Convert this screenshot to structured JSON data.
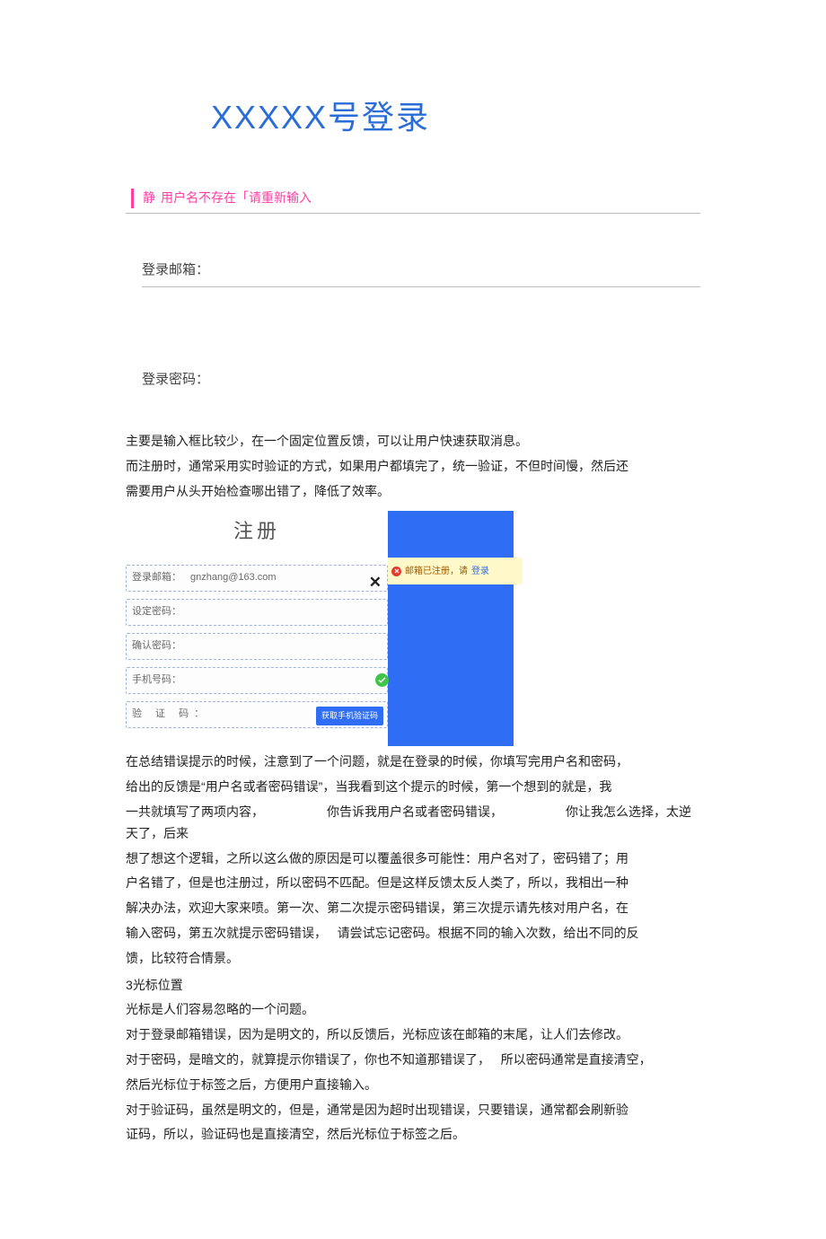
{
  "title": "XXXXX号登录",
  "error": {
    "jing": "静",
    "text": "用户名不存在「请重新输入"
  },
  "fields": {
    "email_label": "登录邮箱：",
    "password_label": "登录密码："
  },
  "para1": {
    "l1": "主要是输入框比较少，在一个固定位置反馈，可以让用户快速获取消息。",
    "l2": "而注册时，通常采用实时验证的方式，如果用户都填完了，统一验证，不但时间慢，然后还",
    "l3": "需要用户从头开始检查哪出错了，降低了效率。"
  },
  "embed": {
    "title": "注册",
    "email": {
      "label": "登录邮箱：",
      "value": "gnzhang@163.com"
    },
    "set_pwd_label": "设定密码：",
    "confirm_pwd_label": "确认密码：",
    "phone_label": "手机号码：",
    "verify_label": "验 证 码：",
    "get_code": "获取手机验证码",
    "warn_prefix": "邮箱已注册，请",
    "warn_login": "登录"
  },
  "para2": {
    "l1": "在总结错误提示的时候，注意到了一个问题，就是在登录的时候，你填写完用户名和密码，",
    "l2": "给出的反馈是“用户名或者密码错误”，当我看到这个提示的时候，第一个想到的就是，我",
    "l3a": "一共就填写了两项内容，",
    "l3b": "你告诉我用户名或者密码错误，",
    "l3c": "你让我怎么选择，太逆天了，后来",
    "l4": "想了想这个逻辑，之所以这么做的原因是可以覆盖很多可能性：用户名对了，密码错了；用",
    "l5": "户名错了，但是也注册过，所以密码不匹配。但是这样反馈太反人类了，所以，我相出一种",
    "l6": "解决办法，欢迎大家来喷。第一次、第二次提示密码错误，第三次提示请先核对用户名，在",
    "l7a": "输入密码，第五次就提示密码错误，",
    "l7b": "请尝试忘记密码。根据不同的输入次数，给出不同的反",
    "l8": "馈，比较符合情景。"
  },
  "section3": {
    "h": "3光标位置",
    "l1": "光标是人们容易忽略的一个问题。",
    "l2": "对于登录邮箱错误，因为是明文的，所以反馈后，光标应该在邮箱的末尾，让人们去修改。",
    "l3a": "对于密码，是暗文的，就算提示你错误了，你也不知道那错误了，",
    "l3b": "所以密码通常是直接清空，",
    "l4": "然后光标位于标签之后，方便用户直接输入。",
    "l5": "对于验证码，虽然是明文的，但是，通常是因为超时出现错误，只要错误，通常都会刷新验",
    "l6": "证码，所以，验证码也是直接清空，然后光标位于标签之后。"
  }
}
